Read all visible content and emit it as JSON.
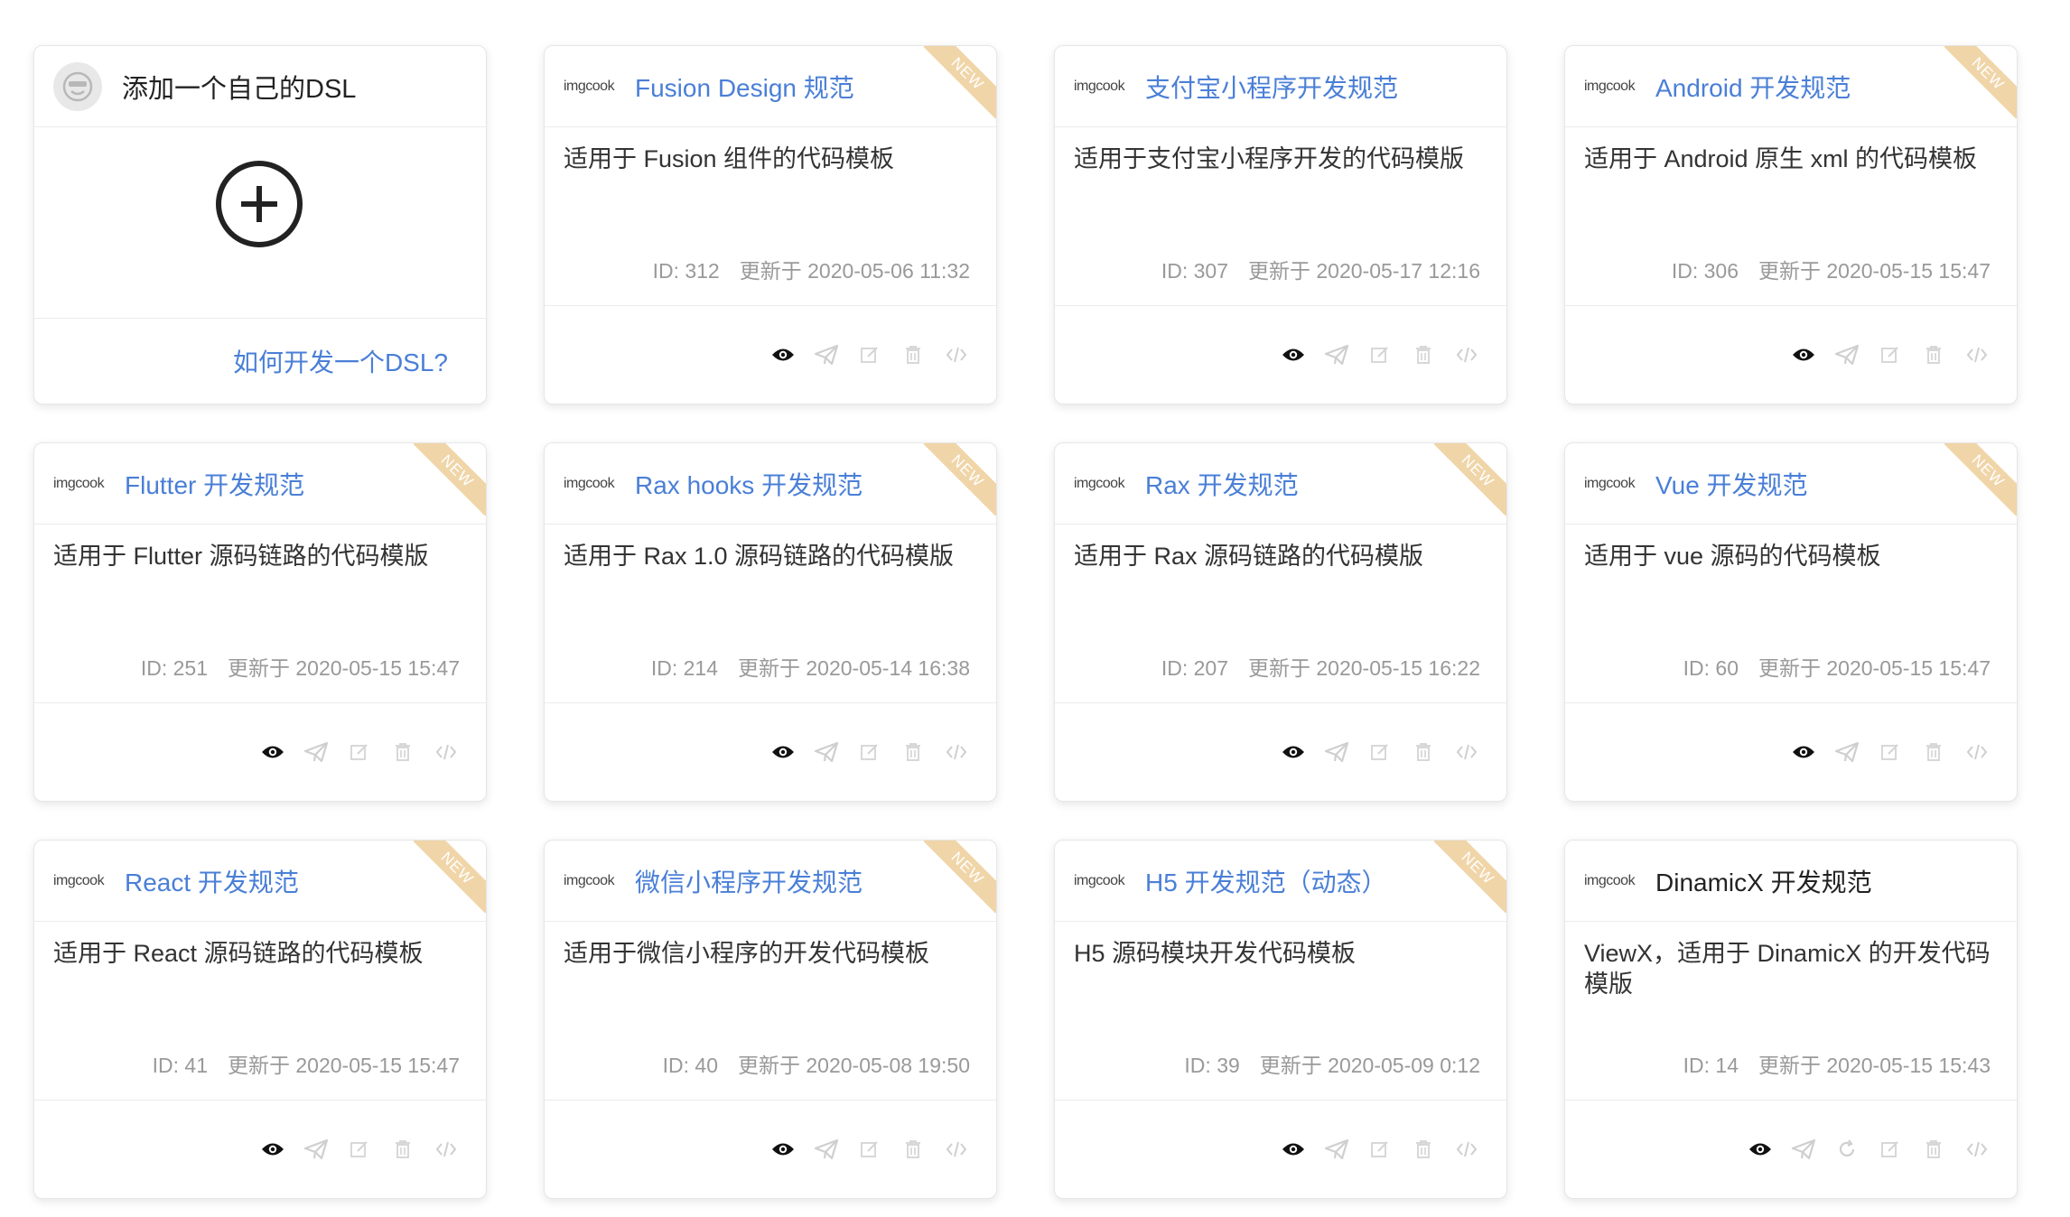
{
  "add_card": {
    "title": "添加一个自己的DSL",
    "link": "如何开发一个DSL?"
  },
  "colors": {
    "link": "#4a7fd7",
    "ribbon": "#f0d5a8"
  },
  "ribbon_label": "NEW",
  "logo_text": "imgcook",
  "cards": [
    {
      "title": "Fusion Design 规范",
      "desc": "适用于 Fusion 组件的代码模板",
      "id": "ID: 312",
      "updated": "更新于 2020-05-06 11:32",
      "is_new": true,
      "icons": [
        "eye-icon",
        "publish-icon",
        "edit-icon",
        "delete-icon",
        "code-icon"
      ]
    },
    {
      "title": "支付宝小程序开发规范",
      "desc": "适用于支付宝小程序开发的代码模版",
      "id": "ID: 307",
      "updated": "更新于 2020-05-17 12:16",
      "is_new": false,
      "icons": [
        "eye-icon",
        "publish-icon",
        "edit-icon",
        "delete-icon",
        "code-icon"
      ]
    },
    {
      "title": "Android 开发规范",
      "desc": "适用于 Android 原生 xml 的代码模板",
      "id": "ID: 306",
      "updated": "更新于 2020-05-15 15:47",
      "is_new": true,
      "icons": [
        "eye-icon",
        "publish-icon",
        "edit-icon",
        "delete-icon",
        "code-icon"
      ]
    },
    {
      "title": "Flutter 开发规范",
      "desc": "适用于 Flutter 源码链路的代码模版",
      "id": "ID: 251",
      "updated": "更新于 2020-05-15 15:47",
      "is_new": true,
      "icons": [
        "eye-icon",
        "publish-icon",
        "edit-icon",
        "delete-icon",
        "code-icon"
      ]
    },
    {
      "title": "Rax hooks 开发规范",
      "desc": "适用于 Rax 1.0 源码链路的代码模版",
      "id": "ID: 214",
      "updated": "更新于 2020-05-14 16:38",
      "is_new": true,
      "icons": [
        "eye-icon",
        "publish-icon",
        "edit-icon",
        "delete-icon",
        "code-icon"
      ]
    },
    {
      "title": "Rax 开发规范",
      "desc": "适用于 Rax 源码链路的代码模版",
      "id": "ID: 207",
      "updated": "更新于 2020-05-15 16:22",
      "is_new": true,
      "icons": [
        "eye-icon",
        "publish-icon",
        "edit-icon",
        "delete-icon",
        "code-icon"
      ]
    },
    {
      "title": "Vue 开发规范",
      "desc": "适用于 vue 源码的代码模板",
      "id": "ID: 60",
      "updated": "更新于 2020-05-15 15:47",
      "is_new": true,
      "icons": [
        "eye-icon",
        "publish-icon",
        "edit-icon",
        "delete-icon",
        "code-icon"
      ]
    },
    {
      "title": "React 开发规范",
      "desc": "适用于 React 源码链路的代码模板",
      "id": "ID: 41",
      "updated": "更新于 2020-05-15 15:47",
      "is_new": true,
      "icons": [
        "eye-icon",
        "publish-icon",
        "edit-icon",
        "delete-icon",
        "code-icon"
      ]
    },
    {
      "title": "微信小程序开发规范",
      "desc": "适用于微信小程序的开发代码模板",
      "id": "ID: 40",
      "updated": "更新于 2020-05-08 19:50",
      "is_new": true,
      "icons": [
        "eye-icon",
        "publish-icon",
        "edit-icon",
        "delete-icon",
        "code-icon"
      ]
    },
    {
      "title": "H5 开发规范（动态）",
      "desc": "H5 源码模块开发代码模板",
      "id": "ID: 39",
      "updated": "更新于 2020-05-09 0:12",
      "is_new": true,
      "icons": [
        "eye-icon",
        "publish-icon",
        "edit-icon",
        "delete-icon",
        "code-icon"
      ]
    },
    {
      "title": "DinamicX 开发规范",
      "desc": "ViewX，适用于 DinamicX 的开发代码模版",
      "id": "ID: 14",
      "updated": "更新于 2020-05-15 15:43",
      "is_new": false,
      "title_dark": true,
      "icons": [
        "eye-icon",
        "publish-icon",
        "refresh-icon",
        "edit-icon",
        "delete-icon",
        "code-icon"
      ]
    }
  ]
}
